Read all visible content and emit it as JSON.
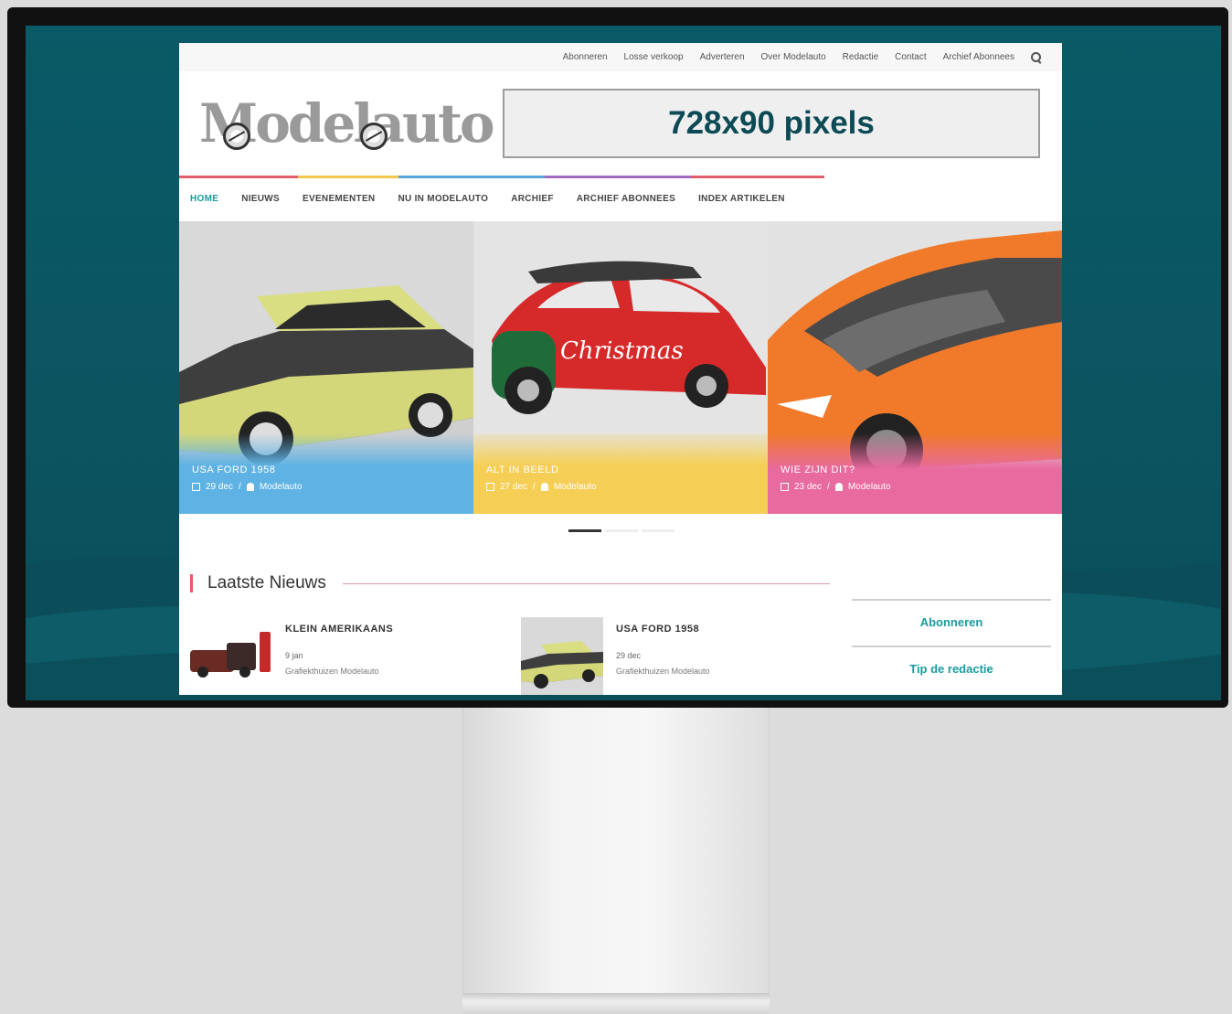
{
  "topnav": {
    "items": [
      "Abonneren",
      "Losse verkoop",
      "Adverteren",
      "Over Modelauto",
      "Redactie",
      "Contact",
      "Archief Abonnees"
    ]
  },
  "header": {
    "logo_text": "Modelauto",
    "ad_text": "728x90 pixels"
  },
  "mainnav": {
    "items": [
      "HOME",
      "NIEUWS",
      "EVENEMENTEN",
      "NU IN MODELAUTO",
      "ARCHIEF",
      "ARCHIEF ABONNEES",
      "INDEX ARTIKELEN"
    ]
  },
  "slider": {
    "slides": [
      {
        "title": "USA FORD 1958",
        "date": "29 dec",
        "author": "Modelauto",
        "color": "#5fb3e4"
      },
      {
        "title": "ALT IN BEELD",
        "date": "27 dec",
        "author": "Modelauto",
        "color": "#f5cf55"
      },
      {
        "title": "WIE ZIJN DIT?",
        "date": "23 dec",
        "author": "Modelauto",
        "color": "#e86a9f"
      }
    ],
    "active_index": 0
  },
  "news": {
    "heading": "Laatste Nieuws",
    "items": [
      {
        "title": "KLEIN AMERIKAANS",
        "date": "9 jan",
        "author": "Grafiekthuizen Modelauto"
      },
      {
        "title": "USA FORD 1958",
        "date": "29 dec",
        "author": "Grafiekthuizen Modelauto"
      }
    ]
  },
  "sidebar": {
    "links": [
      "Abonneren",
      "Tip de redactie"
    ]
  },
  "colors": {
    "accent": "#1a9b9e",
    "screen_bg": "#0a5a67",
    "ad_text": "#0c4a55"
  }
}
